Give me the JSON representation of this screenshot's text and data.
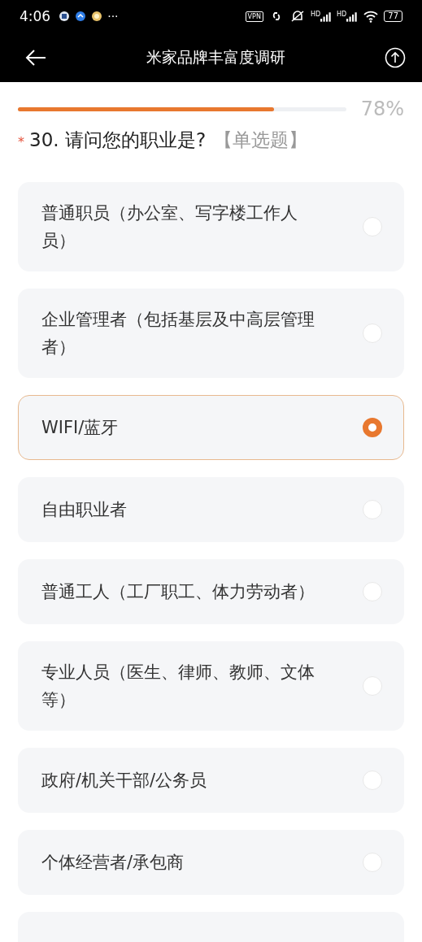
{
  "status_bar": {
    "time": "4:06",
    "more": "···",
    "vpn": "VPN",
    "signal_labels": [
      "HD",
      "HD"
    ],
    "battery": "77"
  },
  "header": {
    "title": "米家品牌丰富度调研"
  },
  "progress": {
    "level": 0.78,
    "reading": "78%"
  },
  "question": {
    "required_mark": "*",
    "text": "30. 请问您的职业是?",
    "type_label": "【单选题】"
  },
  "options": [
    {
      "label": "普通职员（办公室、写字楼工作人员）",
      "selected": false
    },
    {
      "label": "企业管理者（包括基层及中高层管理者）",
      "selected": false
    },
    {
      "label": "WIFI/蓝牙",
      "selected": true
    },
    {
      "label": "自由职业者",
      "selected": false
    },
    {
      "label": "普通工人（工厂职工、体力劳动者）",
      "selected": false
    },
    {
      "label": "专业人员（医生、律师、教师、文体等）",
      "selected": false
    },
    {
      "label": "政府/机关干部/公务员",
      "selected": false
    },
    {
      "label": "个体经营者/承包商",
      "selected": false
    }
  ]
}
